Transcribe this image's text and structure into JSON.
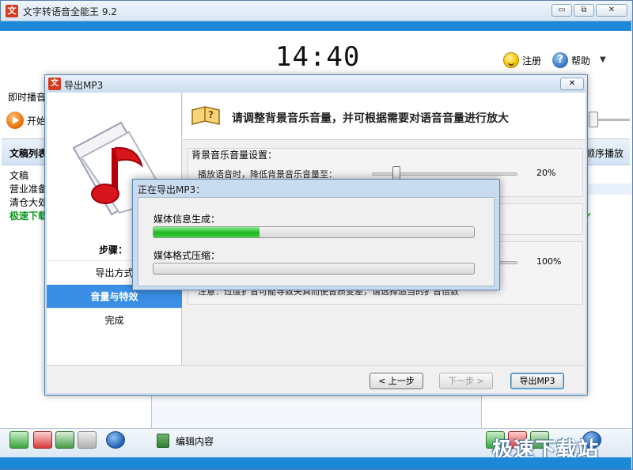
{
  "app": {
    "title": "文字转语音全能王 9.2",
    "window_buttons": {
      "minimize": "▭",
      "restore": "⧉",
      "close": "✕"
    },
    "clock": "14:40",
    "register_label": "注册",
    "help_label": "帮助",
    "dropdown_glyph": "▼",
    "left_tab": "即时播音",
    "start_label": "开始",
    "list_header": "文稿列表",
    "left_rows": [
      "文稿",
      "营业准备",
      "清仓大处",
      "极速下载"
    ],
    "right_header": "顺序播放",
    "right_check": "✔",
    "edit_content": "编辑内容",
    "watermark": "极速下载站",
    "icons": [
      "add-icon",
      "delete-icon",
      "import-icon",
      "export-icon",
      "play-icon",
      "doc-icon",
      "smile-icon",
      "help-icon"
    ],
    "accent_blue": "#1e88d8"
  },
  "export_dialog": {
    "title": "导出MP3",
    "close_glyph": "✕",
    "banner_text": "请调整背景音乐音量，并可根据需要对语音音量进行放大",
    "steps_label": "步骤：",
    "steps": [
      {
        "label": "导出方式",
        "active": false
      },
      {
        "label": "音量与特效",
        "active": true
      },
      {
        "label": "完成",
        "active": false
      }
    ],
    "bg_group_title": "背景音乐音量设置：",
    "bg_line1": "播放语音时，降低背景音乐音量至：",
    "bg_line1_value": "20%",
    "voice_value": "100%",
    "note": "注意：过度扩音可能导致失真而使音质变差，请选择适当的扩音倍数",
    "buttons": {
      "prev": "< 上一步",
      "next": "下一步 >",
      "export": "导出MP3"
    }
  },
  "progress_dialog": {
    "title": "正在导出MP3：",
    "item1_label": "媒体信息生成：",
    "item1_progress": 0.33,
    "item2_label": "媒体格式压缩：",
    "item2_progress": 0.0
  }
}
